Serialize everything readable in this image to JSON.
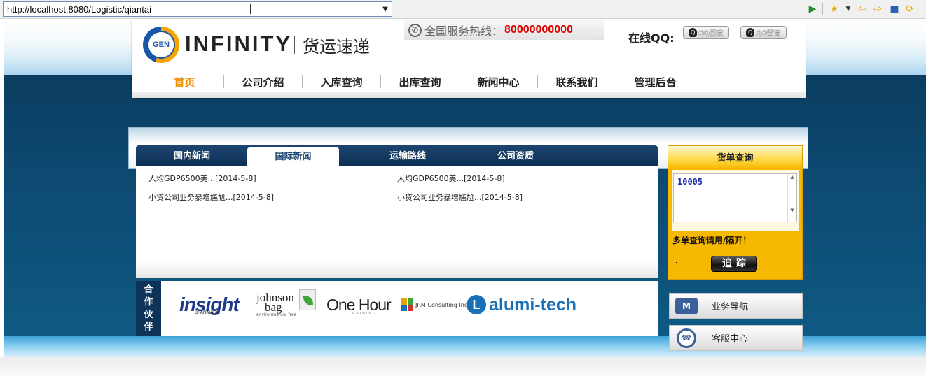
{
  "browser": {
    "url": "http://localhost:8080/Logistic/qiantai",
    "icons": [
      "play-icon",
      "add-bookmark-icon",
      "dropdown-icon",
      "back-icon",
      "forward-icon",
      "stop-icon",
      "refresh-icon"
    ]
  },
  "header": {
    "logo_text": "GEN",
    "brand": "INFINITY",
    "brand_cn": "货运速递",
    "hotline_label": "全国服务热线：",
    "hotline_number": "80000000000",
    "qq_label": "在线QQ:",
    "qq_buttons": [
      "QQ留言",
      "QQ留言"
    ]
  },
  "nav": {
    "items": [
      "首页",
      "公司介绍",
      "入库查询",
      "出库查询",
      "新闻中心",
      "联系我们",
      "管理后台"
    ],
    "active_index": 0
  },
  "news": {
    "tabs": [
      "国内新闻",
      "国际新闻",
      "运输路线",
      "公司资质"
    ],
    "active_tab": 1,
    "items": [
      "人均GDP6500美...[2014-5-8]",
      "人均GDP6500美...[2014-5-8]",
      "小贷公司业务暴增尴尬...[2014-5-8]",
      "小贷公司业务暴增尴尬...[2014-5-8]"
    ]
  },
  "partners": {
    "label": [
      "合",
      "作",
      "伙",
      "伴"
    ],
    "logos": {
      "insight": "insight",
      "insight_sub": "BJ ANALYSIS",
      "johnson_1": "johnson",
      "johnson_2": "bag",
      "johnson_sub": "environmental free",
      "onehour": "One Hour",
      "onehour_sub": "TRAINING",
      "jrm": "JRM Consulting Inc",
      "alumi": "alumi-tech"
    }
  },
  "tracking": {
    "title": "货单查询",
    "value": "10005",
    "hint": "多单查询请用/隔开！",
    "button": "追踪"
  },
  "side_links": [
    {
      "label": "业务导航",
      "icon": "business-nav-icon"
    },
    {
      "label": "客服中心",
      "icon": "customer-service-icon"
    }
  ],
  "colors": {
    "accent": "#f08c00",
    "dark_blue": "#0d3458",
    "hotline_red": "#e00000",
    "track_yellow": "#f6b800"
  }
}
